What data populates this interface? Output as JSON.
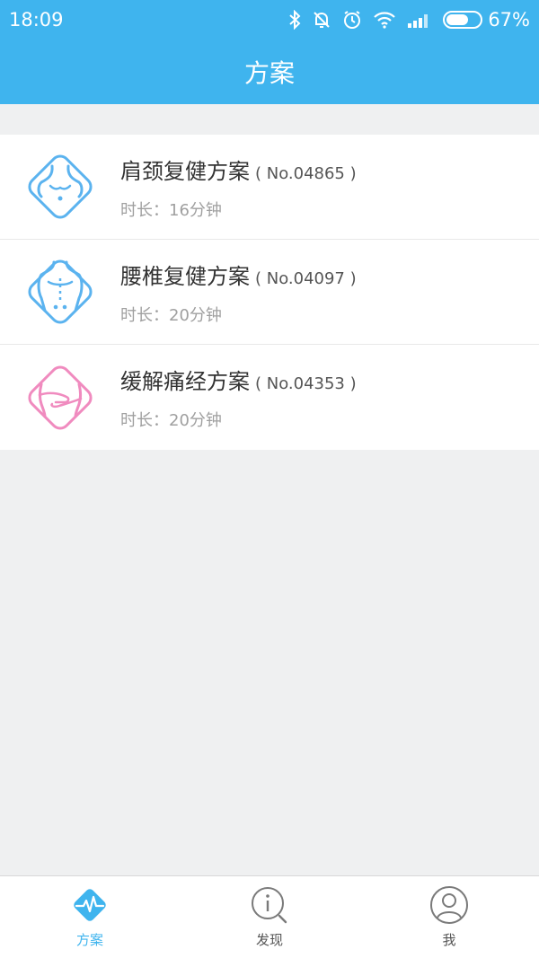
{
  "status_bar": {
    "time": "18:09",
    "battery_percent_label": "67%",
    "battery_level": 0.67
  },
  "header": {
    "title": "方案"
  },
  "plans": [
    {
      "title": "肩颈复健方案",
      "code": "( No.04865 )",
      "duration": "时长：16分钟",
      "icon": "shoulder-neck-icon",
      "color": "#5bb3ef"
    },
    {
      "title": "腰椎复健方案",
      "code": "( No.04097 )",
      "duration": "时长：20分钟",
      "icon": "lumbar-back-icon",
      "color": "#5bb3ef"
    },
    {
      "title": "缓解痛经方案",
      "code": "( No.04353 )",
      "duration": "时长：20分钟",
      "icon": "abdomen-icon",
      "color": "#f08bbf"
    }
  ],
  "tabs": [
    {
      "label": "方案",
      "icon": "pulse-icon",
      "active": true
    },
    {
      "label": "发现",
      "icon": "info-search-icon",
      "active": false
    },
    {
      "label": "我",
      "icon": "user-icon",
      "active": false
    }
  ],
  "colors": {
    "accent": "#3fb4ee",
    "pink": "#f08bbf"
  }
}
